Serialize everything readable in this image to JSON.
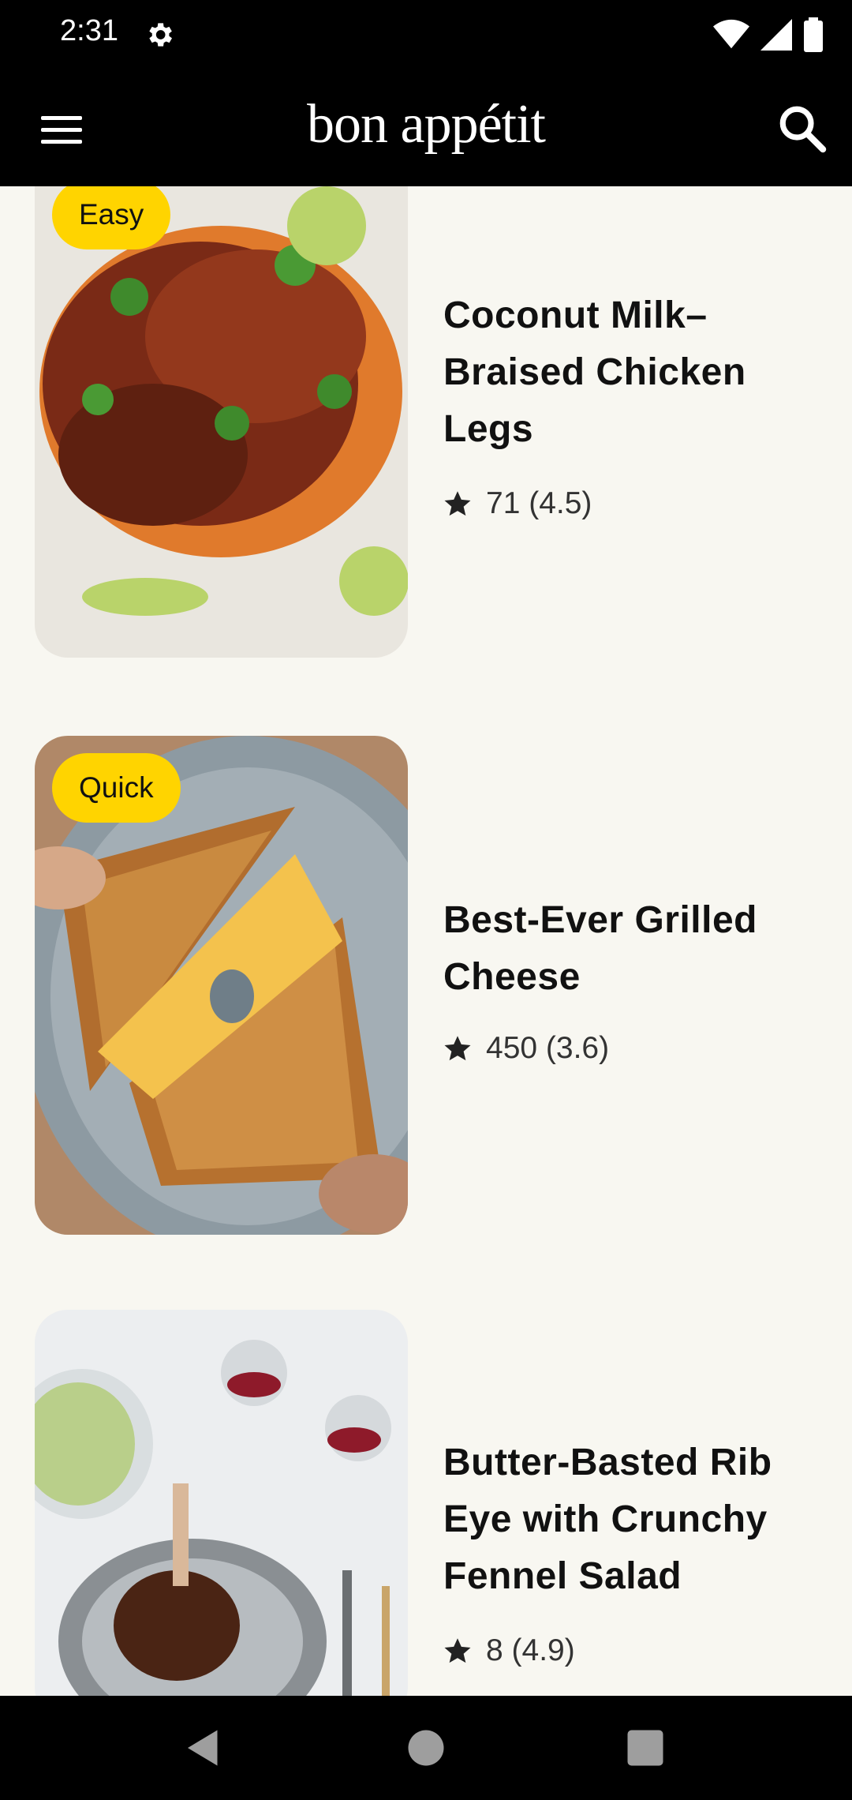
{
  "status_bar": {
    "time": "2:31"
  },
  "app_bar": {
    "brand": "bon appétit"
  },
  "recipes": [
    {
      "badge": "Easy",
      "title": "Coconut Milk–Braised Chicken Legs",
      "rating_text": "71 (4.5)"
    },
    {
      "badge": "Quick",
      "title": "Best-Ever Grilled Cheese",
      "rating_text": "450 (3.6)"
    },
    {
      "badge": "",
      "title": "Butter-Basted Rib Eye with Crunchy Fennel Salad",
      "rating_text": "8 (4.9)"
    }
  ],
  "colors": {
    "badge": "#ffd400",
    "background": "#f8f7f1",
    "bar": "#000000"
  },
  "icons": [
    "gear-icon",
    "wifi-icon",
    "signal-icon",
    "battery-icon",
    "menu-icon",
    "search-icon",
    "star-icon",
    "back-icon",
    "home-icon",
    "recents-icon"
  ]
}
